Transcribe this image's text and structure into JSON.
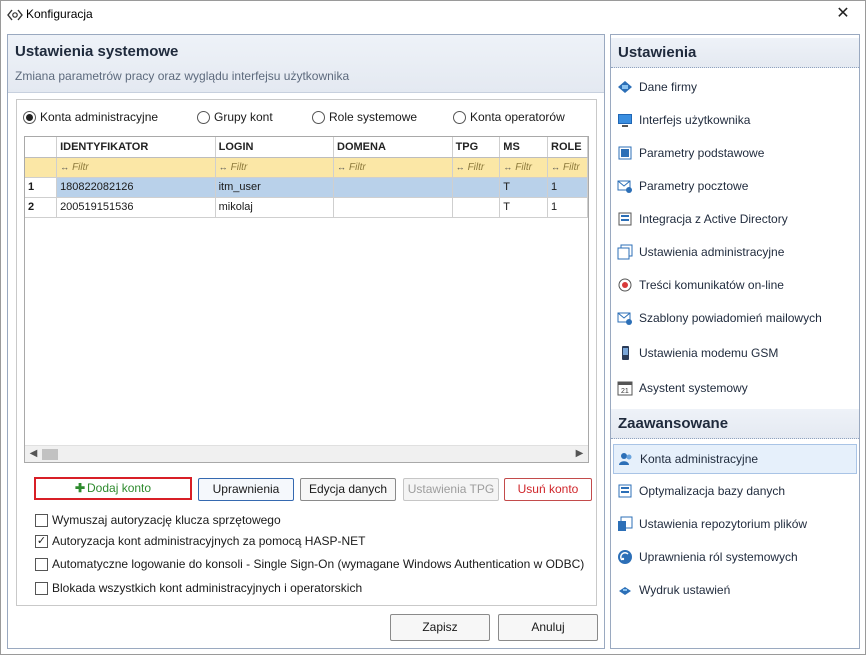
{
  "window": {
    "title": "Konfiguracja",
    "close_glyph": "✕"
  },
  "left": {
    "title": "Ustawienia systemowe",
    "subtitle": "Zmiana parametrów pracy oraz wyglądu interfejsu użytkownika",
    "radios": [
      {
        "label": "Konta administracyjne",
        "checked": true
      },
      {
        "label": "Grupy kont",
        "checked": false
      },
      {
        "label": "Role systemowe",
        "checked": false
      },
      {
        "label": "Konta operatorów",
        "checked": false
      }
    ],
    "grid": {
      "columns": [
        "IDENTYFIKATOR",
        "LOGIN",
        "DOMENA",
        "TPG",
        "MS",
        "ROLE"
      ],
      "filter_placeholder": "Filtr",
      "filter_icon": "↔",
      "rows": [
        {
          "num": "1",
          "cells": [
            "180822082126",
            "itm_user",
            "",
            "",
            "T",
            "1"
          ],
          "selected": true
        },
        {
          "num": "2",
          "cells": [
            "200519151536",
            "mikolaj",
            "",
            "",
            "T",
            "1"
          ],
          "selected": false
        }
      ]
    },
    "buttons": {
      "add": "Dodaj konto",
      "permissions": "Uprawnienia",
      "edit": "Edycja danych",
      "tpg": "Ustawienia TPG",
      "delete": "Usuń konto"
    },
    "checkboxes": [
      {
        "label": "Wymuszaj autoryzację klucza sprzętowego",
        "checked": false
      },
      {
        "label": "Autoryzacja kont administracyjnych za pomocą HASP-NET",
        "checked": true
      },
      {
        "label": "Automatyczne logowanie do konsoli - Single Sign-On (wymagane Windows Authentication w ODBC)",
        "checked": false
      },
      {
        "label": "Blokada wszystkich kont administracyjnych i operatorskich",
        "checked": false
      }
    ],
    "footer": {
      "save": "Zapisz",
      "cancel": "Anuluj"
    }
  },
  "right": {
    "section1": "Ustawienia",
    "items1": [
      {
        "label": "Dane firmy",
        "icon": "company-icon"
      },
      {
        "label": "Interfejs użytkownika",
        "icon": "monitor-icon"
      },
      {
        "label": "Parametry podstawowe",
        "icon": "parameters-icon"
      },
      {
        "label": "Parametry pocztowe",
        "icon": "mail-settings-icon"
      },
      {
        "label": "Integracja z Active Directory",
        "icon": "directory-icon"
      },
      {
        "label": "Ustawienia administracyjne",
        "icon": "admin-settings-icon"
      },
      {
        "label": "Treści komunikatów on-line",
        "icon": "messages-icon"
      },
      {
        "label": "Szablony powiadomień mailowych",
        "icon": "mail-templates-icon"
      },
      {
        "label": "Ustawienia modemu GSM",
        "icon": "phone-icon"
      },
      {
        "label": "Asystent systemowy",
        "icon": "calendar-icon"
      }
    ],
    "section2": "Zaawansowane",
    "items2": [
      {
        "label": "Konta administracyjne",
        "icon": "accounts-icon",
        "active": true
      },
      {
        "label": "Optymalizacja bazy danych",
        "icon": "database-icon",
        "active": false
      },
      {
        "label": "Ustawienia repozytorium plików",
        "icon": "repository-icon",
        "active": false
      },
      {
        "label": "Uprawnienia ról systemowych",
        "icon": "role-permissions-icon",
        "active": false
      },
      {
        "label": "Wydruk ustawień",
        "icon": "print-icon",
        "active": false
      }
    ]
  }
}
